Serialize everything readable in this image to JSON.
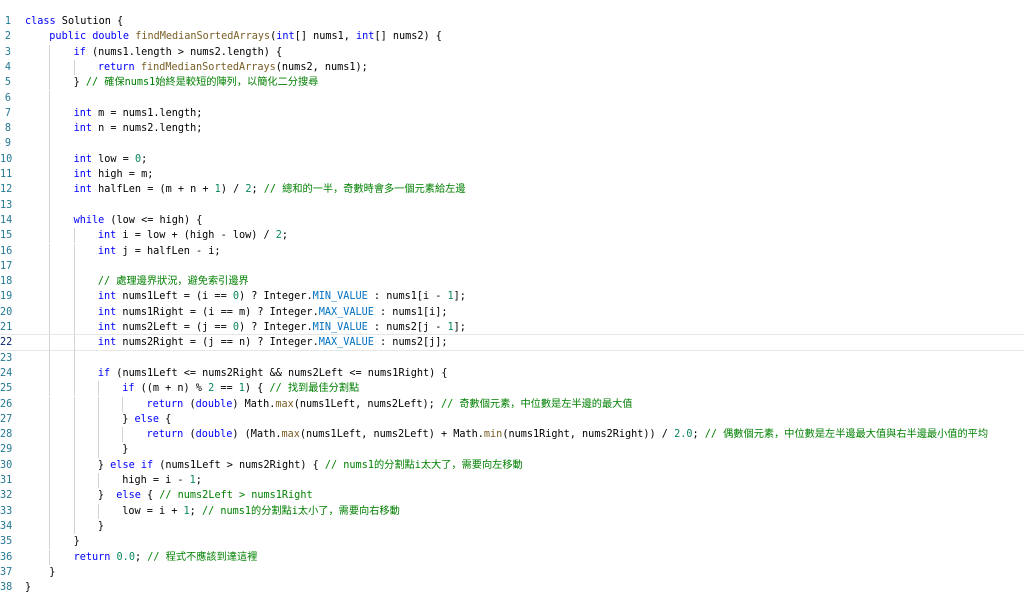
{
  "editor": {
    "language": "java",
    "current_line": 22,
    "lines": [
      {
        "n": 1,
        "indent": 0,
        "tokens": [
          [
            "kw",
            "class"
          ],
          [
            "p",
            " Solution {"
          ]
        ]
      },
      {
        "n": 2,
        "indent": 1,
        "tokens": [
          [
            "kw",
            "public"
          ],
          [
            "p",
            " "
          ],
          [
            "kw",
            "double"
          ],
          [
            "p",
            " "
          ],
          [
            "fn",
            "findMedianSortedArrays"
          ],
          [
            "p",
            "("
          ],
          [
            "kw",
            "int"
          ],
          [
            "p",
            "[] nums1, "
          ],
          [
            "kw",
            "int"
          ],
          [
            "p",
            "[] nums2) {"
          ]
        ]
      },
      {
        "n": 3,
        "indent": 2,
        "tokens": [
          [
            "kw",
            "if"
          ],
          [
            "p",
            " (nums1.length > nums2.length) {"
          ]
        ]
      },
      {
        "n": 4,
        "indent": 3,
        "tokens": [
          [
            "kw",
            "return"
          ],
          [
            "p",
            " "
          ],
          [
            "fn",
            "findMedianSortedArrays"
          ],
          [
            "p",
            "(nums2, nums1);"
          ]
        ]
      },
      {
        "n": 5,
        "indent": 2,
        "tokens": [
          [
            "p",
            "} "
          ],
          [
            "cm",
            "// 確保nums1始終是較短的陣列，以簡化二分搜尋"
          ]
        ]
      },
      {
        "n": 6,
        "indent": 0,
        "tokens": []
      },
      {
        "n": 7,
        "indent": 2,
        "tokens": [
          [
            "kw",
            "int"
          ],
          [
            "p",
            " m = nums1.length;"
          ]
        ]
      },
      {
        "n": 8,
        "indent": 2,
        "tokens": [
          [
            "kw",
            "int"
          ],
          [
            "p",
            " n = nums2.length;"
          ]
        ]
      },
      {
        "n": 9,
        "indent": 0,
        "tokens": []
      },
      {
        "n": 10,
        "indent": 2,
        "tokens": [
          [
            "kw",
            "int"
          ],
          [
            "p",
            " low = "
          ],
          [
            "num",
            "0"
          ],
          [
            "p",
            ";"
          ]
        ]
      },
      {
        "n": 11,
        "indent": 2,
        "tokens": [
          [
            "kw",
            "int"
          ],
          [
            "p",
            " high = m;"
          ]
        ]
      },
      {
        "n": 12,
        "indent": 2,
        "tokens": [
          [
            "kw",
            "int"
          ],
          [
            "p",
            " halfLen = (m + n + "
          ],
          [
            "num",
            "1"
          ],
          [
            "p",
            ") / "
          ],
          [
            "num",
            "2"
          ],
          [
            "p",
            "; "
          ],
          [
            "cm",
            "// 總和的一半，奇數時會多一個元素給左邊"
          ]
        ]
      },
      {
        "n": 13,
        "indent": 0,
        "tokens": []
      },
      {
        "n": 14,
        "indent": 2,
        "tokens": [
          [
            "kw",
            "while"
          ],
          [
            "p",
            " (low <= high) {"
          ]
        ]
      },
      {
        "n": 15,
        "indent": 3,
        "tokens": [
          [
            "kw",
            "int"
          ],
          [
            "p",
            " i = low + (high - low) / "
          ],
          [
            "num",
            "2"
          ],
          [
            "p",
            ";"
          ]
        ]
      },
      {
        "n": 16,
        "indent": 3,
        "tokens": [
          [
            "kw",
            "int"
          ],
          [
            "p",
            " j = halfLen - i;"
          ]
        ]
      },
      {
        "n": 17,
        "indent": 0,
        "tokens": []
      },
      {
        "n": 18,
        "indent": 3,
        "tokens": [
          [
            "cm",
            "// 處理邊界狀況，避免索引邊界"
          ]
        ]
      },
      {
        "n": 19,
        "indent": 3,
        "tokens": [
          [
            "kw",
            "int"
          ],
          [
            "p",
            " nums1Left = (i == "
          ],
          [
            "num",
            "0"
          ],
          [
            "p",
            ") ? Integer."
          ],
          [
            "cst",
            "MIN_VALUE"
          ],
          [
            "p",
            " : nums1[i - "
          ],
          [
            "num",
            "1"
          ],
          [
            "p",
            "];"
          ]
        ]
      },
      {
        "n": 20,
        "indent": 3,
        "tokens": [
          [
            "kw",
            "int"
          ],
          [
            "p",
            " nums1Right = (i == m) ? Integer."
          ],
          [
            "cst",
            "MAX_VALUE"
          ],
          [
            "p",
            " : nums1[i];"
          ]
        ]
      },
      {
        "n": 21,
        "indent": 3,
        "tokens": [
          [
            "kw",
            "int"
          ],
          [
            "p",
            " nums2Left = (j == "
          ],
          [
            "num",
            "0"
          ],
          [
            "p",
            ") ? Integer."
          ],
          [
            "cst",
            "MIN_VALUE"
          ],
          [
            "p",
            " : nums2[j - "
          ],
          [
            "num",
            "1"
          ],
          [
            "p",
            "];"
          ]
        ]
      },
      {
        "n": 22,
        "indent": 3,
        "tokens": [
          [
            "kw",
            "int"
          ],
          [
            "p",
            " nums2Right = (j == n) ? Integer."
          ],
          [
            "cst",
            "MAX_VALUE"
          ],
          [
            "p",
            " : nums2[j];"
          ]
        ]
      },
      {
        "n": 23,
        "indent": 0,
        "tokens": []
      },
      {
        "n": 24,
        "indent": 3,
        "tokens": [
          [
            "kw",
            "if"
          ],
          [
            "p",
            " (nums1Left <= nums2Right && nums2Left <= nums1Right) {"
          ]
        ]
      },
      {
        "n": 25,
        "indent": 4,
        "tokens": [
          [
            "kw",
            "if"
          ],
          [
            "p",
            " ((m + n) % "
          ],
          [
            "num",
            "2"
          ],
          [
            "p",
            " == "
          ],
          [
            "num",
            "1"
          ],
          [
            "p",
            ") { "
          ],
          [
            "cm",
            "// 找到最佳分割點"
          ]
        ]
      },
      {
        "n": 26,
        "indent": 5,
        "tokens": [
          [
            "kw",
            "return"
          ],
          [
            "p",
            " ("
          ],
          [
            "kw",
            "double"
          ],
          [
            "p",
            ") Math."
          ],
          [
            "fn",
            "max"
          ],
          [
            "p",
            "(nums1Left, nums2Left); "
          ],
          [
            "cm",
            "// 奇數個元素，中位數是左半邊的最大值"
          ]
        ]
      },
      {
        "n": 27,
        "indent": 4,
        "tokens": [
          [
            "p",
            "} "
          ],
          [
            "kw",
            "else"
          ],
          [
            "p",
            " {"
          ]
        ]
      },
      {
        "n": 28,
        "indent": 5,
        "tokens": [
          [
            "kw",
            "return"
          ],
          [
            "p",
            " ("
          ],
          [
            "kw",
            "double"
          ],
          [
            "p",
            ") (Math."
          ],
          [
            "fn",
            "max"
          ],
          [
            "p",
            "(nums1Left, nums2Left) + Math."
          ],
          [
            "fn",
            "min"
          ],
          [
            "p",
            "(nums1Right, nums2Right)) / "
          ],
          [
            "num",
            "2.0"
          ],
          [
            "p",
            "; "
          ],
          [
            "cm",
            "// 偶數個元素，中位數是左半邊最大值與右半邊最小值的平均"
          ]
        ]
      },
      {
        "n": 29,
        "indent": 4,
        "tokens": [
          [
            "p",
            "}"
          ]
        ]
      },
      {
        "n": 30,
        "indent": 3,
        "tokens": [
          [
            "p",
            "} "
          ],
          [
            "kw",
            "else"
          ],
          [
            "p",
            " "
          ],
          [
            "kw",
            "if"
          ],
          [
            "p",
            " (nums1Left > nums2Right) { "
          ],
          [
            "cm",
            "// nums1的分割點i太大了，需要向左移動"
          ]
        ]
      },
      {
        "n": 31,
        "indent": 4,
        "tokens": [
          [
            "p",
            "high = i - "
          ],
          [
            "num",
            "1"
          ],
          [
            "p",
            ";"
          ]
        ]
      },
      {
        "n": 32,
        "indent": 3,
        "tokens": [
          [
            "p",
            "}  "
          ],
          [
            "kw",
            "else"
          ],
          [
            "p",
            " { "
          ],
          [
            "cm",
            "// nums2Left > nums1Right"
          ]
        ]
      },
      {
        "n": 33,
        "indent": 4,
        "tokens": [
          [
            "p",
            "low = i + "
          ],
          [
            "num",
            "1"
          ],
          [
            "p",
            "; "
          ],
          [
            "cm",
            "// nums1的分割點i太小了，需要向右移動"
          ]
        ]
      },
      {
        "n": 34,
        "indent": 3,
        "tokens": [
          [
            "p",
            "}"
          ]
        ]
      },
      {
        "n": 35,
        "indent": 2,
        "tokens": [
          [
            "p",
            "}"
          ]
        ]
      },
      {
        "n": 36,
        "indent": 2,
        "tokens": [
          [
            "kw",
            "return"
          ],
          [
            "p",
            " "
          ],
          [
            "num",
            "0.0"
          ],
          [
            "p",
            "; "
          ],
          [
            "cm",
            "// 程式不應該到達這裡"
          ]
        ]
      },
      {
        "n": 37,
        "indent": 1,
        "tokens": [
          [
            "p",
            "}"
          ]
        ]
      },
      {
        "n": 38,
        "indent": 0,
        "tokens": [
          [
            "p",
            "}"
          ]
        ]
      }
    ]
  }
}
